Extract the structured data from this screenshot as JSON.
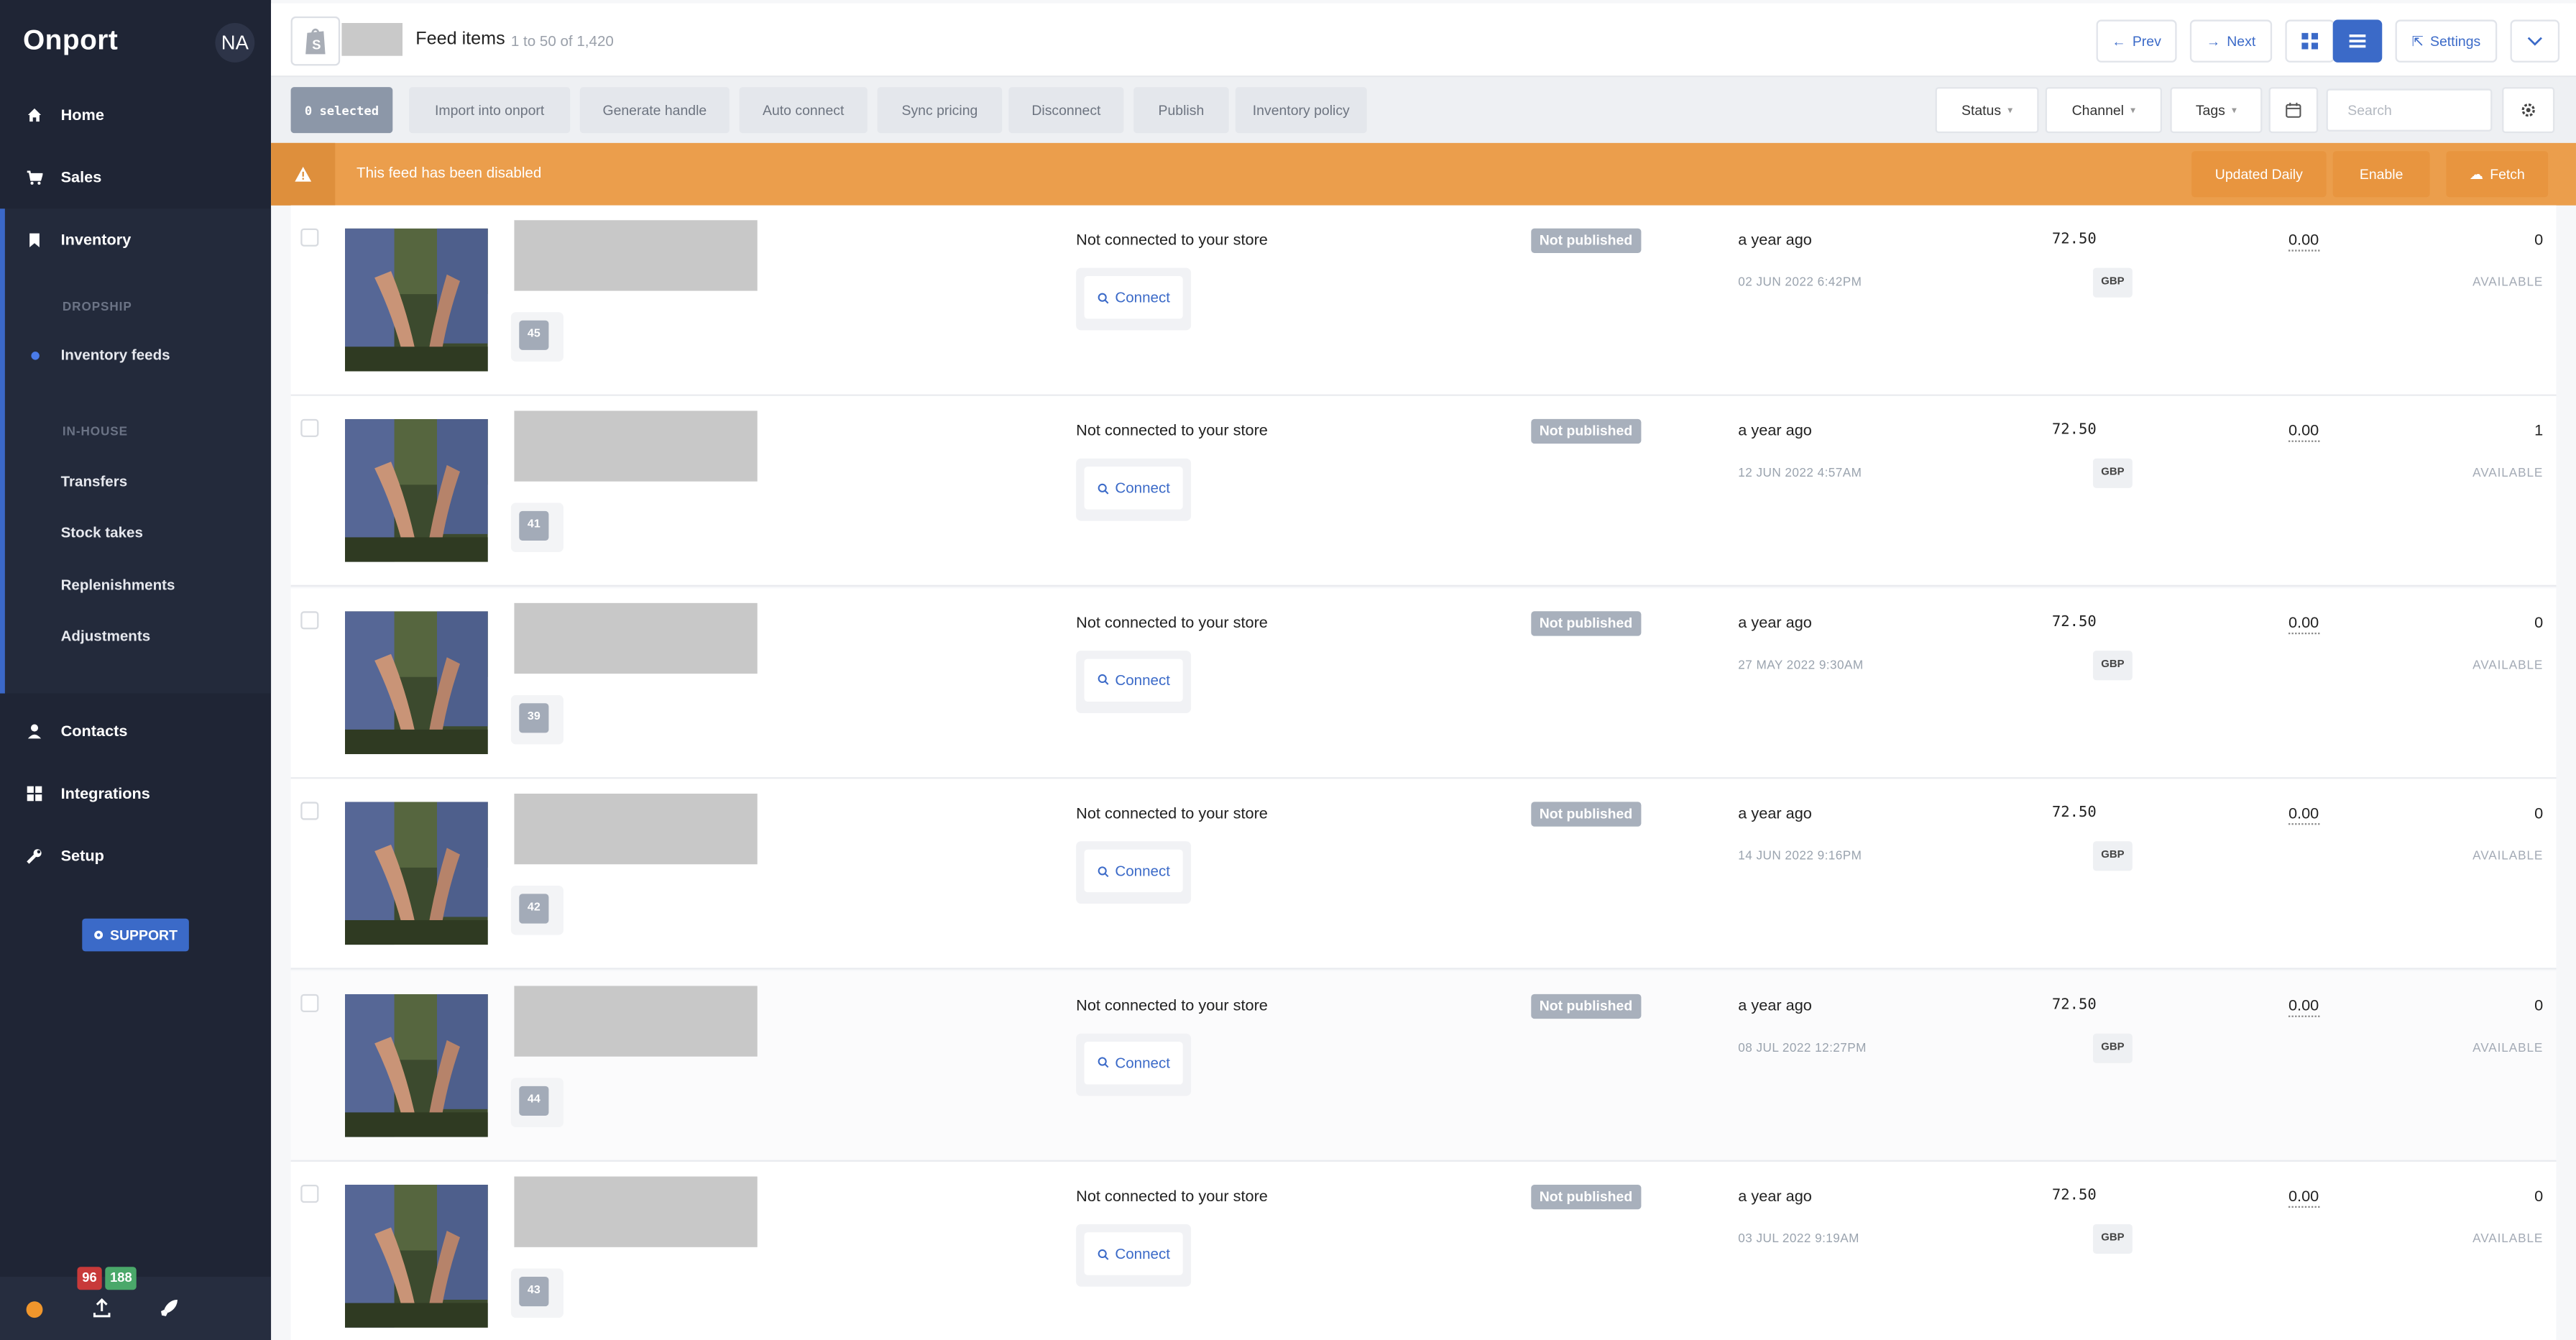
{
  "sidebar": {
    "logo": "Onport",
    "avatar": "NA",
    "nav": {
      "home": "Home",
      "sales": "Sales",
      "inventory": "Inventory",
      "dropship_header": "DROPSHIP",
      "inventory_feeds": "Inventory feeds",
      "inhouse_header": "IN-HOUSE",
      "transfers": "Transfers",
      "stock_takes": "Stock takes",
      "replenishments": "Replenishments",
      "adjustments": "Adjustments",
      "contacts": "Contacts",
      "integrations": "Integrations",
      "setup": "Setup"
    },
    "support": "SUPPORT",
    "badge_red": "96",
    "badge_green": "188"
  },
  "header": {
    "title": "Feed items",
    "subtitle": "1 to 50 of 1,420",
    "prev": "Prev",
    "next": "Next",
    "settings": "Settings"
  },
  "toolbar": {
    "selected": "0 selected",
    "actions": [
      "Import into onport",
      "Generate handle",
      "Auto connect",
      "Sync pricing",
      "Disconnect",
      "Publish",
      "Inventory policy"
    ],
    "filters": {
      "status": "Status",
      "channel": "Channel",
      "tags": "Tags"
    },
    "search_placeholder": "Search"
  },
  "banner": {
    "text": "This feed has been disabled",
    "updated": "Updated Daily",
    "enable": "Enable",
    "fetch": "Fetch"
  },
  "rows": [
    {
      "num": "45",
      "status": "Not connected to your store",
      "connect": "Connect",
      "published": "Not published",
      "ago": "a year ago",
      "date": "02 JUN 2022 6:42PM",
      "price": "72.50",
      "currency": "GBP",
      "cost": "0.00",
      "qty": "0",
      "avail": "AVAILABLE"
    },
    {
      "num": "41",
      "status": "Not connected to your store",
      "connect": "Connect",
      "published": "Not published",
      "ago": "a year ago",
      "date": "12 JUN 2022 4:57AM",
      "price": "72.50",
      "currency": "GBP",
      "cost": "0.00",
      "qty": "1",
      "avail": "AVAILABLE"
    },
    {
      "num": "39",
      "status": "Not connected to your store",
      "connect": "Connect",
      "published": "Not published",
      "ago": "a year ago",
      "date": "27 MAY 2022 9:30AM",
      "price": "72.50",
      "currency": "GBP",
      "cost": "0.00",
      "qty": "0",
      "avail": "AVAILABLE"
    },
    {
      "num": "42",
      "status": "Not connected to your store",
      "connect": "Connect",
      "published": "Not published",
      "ago": "a year ago",
      "date": "14 JUN 2022 9:16PM",
      "price": "72.50",
      "currency": "GBP",
      "cost": "0.00",
      "qty": "0",
      "avail": "AVAILABLE"
    },
    {
      "num": "44",
      "status": "Not connected to your store",
      "connect": "Connect",
      "published": "Not published",
      "ago": "a year ago",
      "date": "08 JUL 2022 12:27PM",
      "price": "72.50",
      "currency": "GBP",
      "cost": "0.00",
      "qty": "0",
      "avail": "AVAILABLE"
    },
    {
      "num": "43",
      "status": "Not connected to your store",
      "connect": "Connect",
      "published": "Not published",
      "ago": "a year ago",
      "date": "03 JUL 2022 9:19AM",
      "price": "72.50",
      "currency": "GBP",
      "cost": "0.00",
      "qty": "0",
      "avail": "AVAILABLE"
    }
  ],
  "colors": {
    "accent": "#3b6ac8",
    "banner": "#eb9e4c",
    "sidebar": "#1f2535"
  }
}
